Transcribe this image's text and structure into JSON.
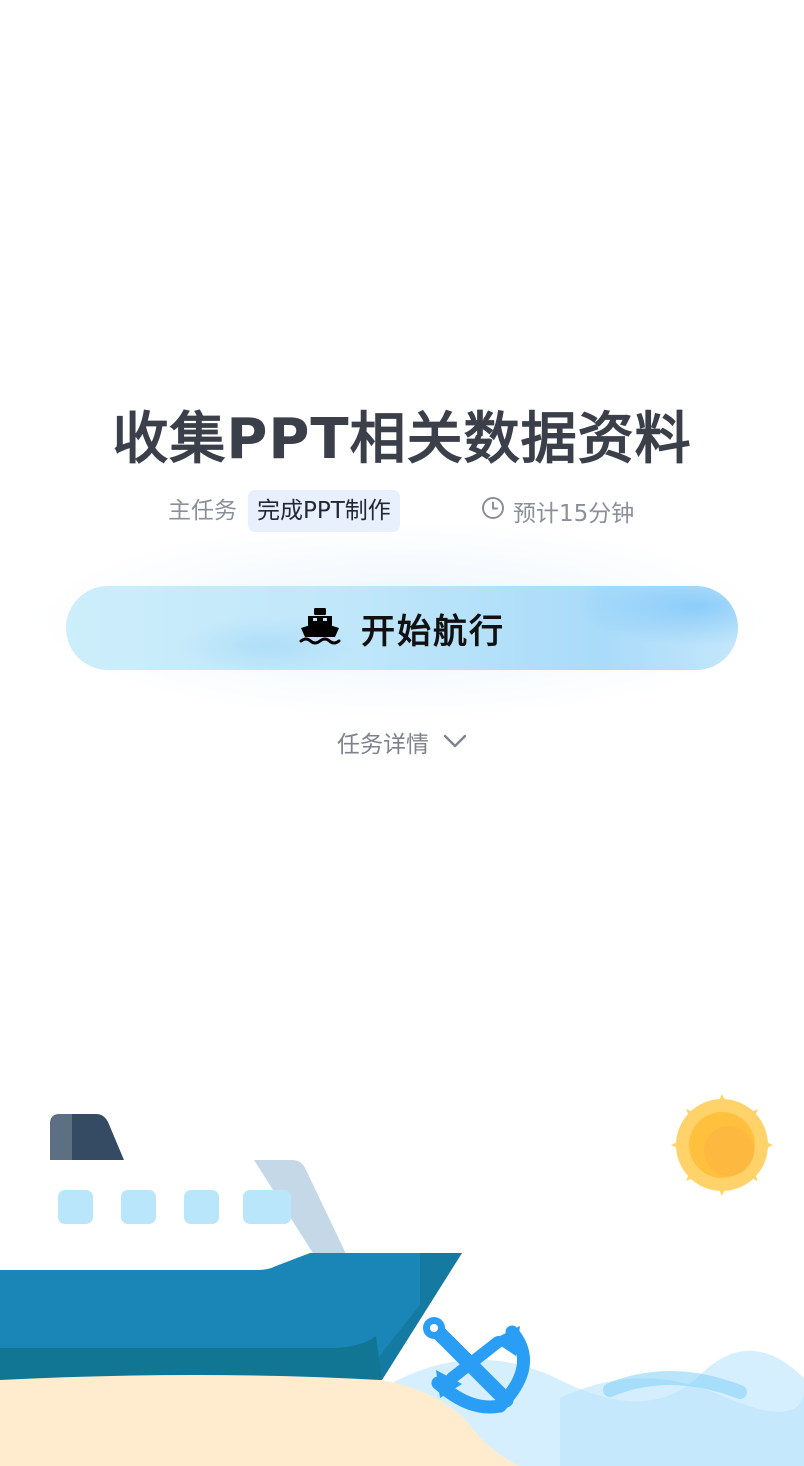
{
  "task": {
    "title": "收集PPT相关数据资料",
    "main_task_label": "主任务",
    "main_task_value": "完成PPT制作",
    "estimate": "预计15分钟"
  },
  "actions": {
    "start_label": "开始航行",
    "details_label": "任务详情"
  },
  "icons": {
    "clock": "clock-icon",
    "ship": "ship-icon",
    "chevron": "chevron-down-icon"
  },
  "colors": {
    "title": "#3b3f4a",
    "muted": "#8a8f99",
    "tag_bg": "#e8f0fd",
    "button_start": "#cdeefb",
    "button_end": "#a9dbfa",
    "ship_hull": "#1a86b8",
    "sun": "#ffc03e",
    "anchor": "#2a9df4"
  }
}
